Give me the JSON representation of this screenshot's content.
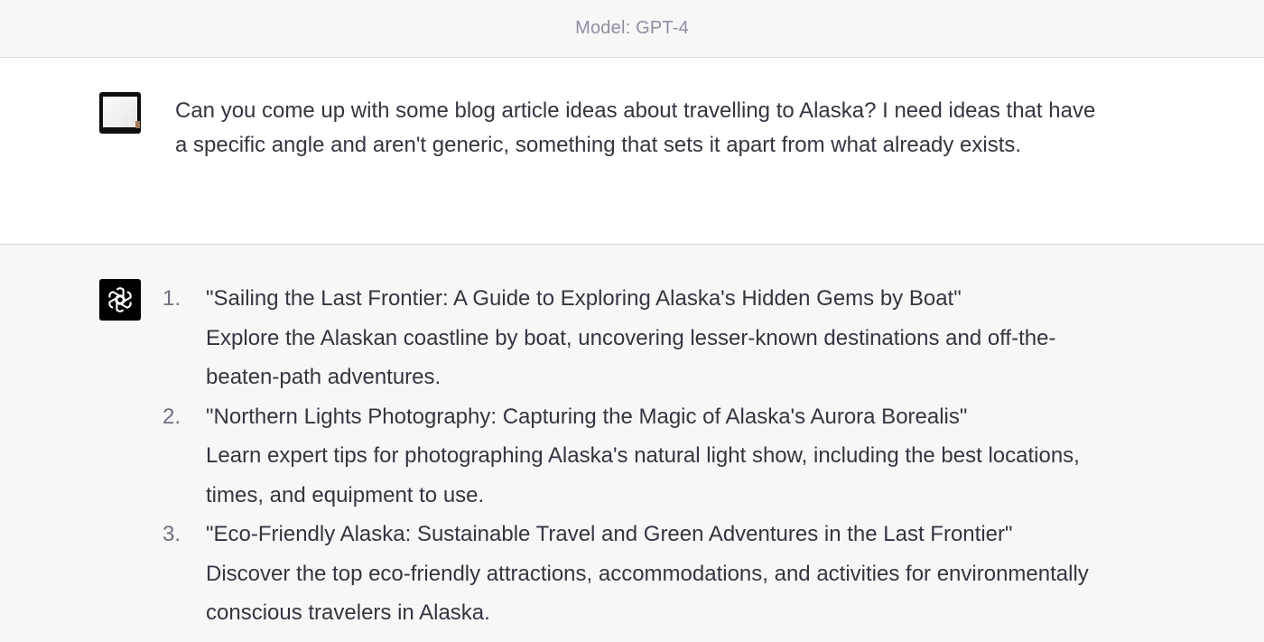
{
  "header": {
    "model_label": "Model: GPT-4"
  },
  "user_message": {
    "text": "Can you come up with some blog article ideas about travelling to Alaska? I need ideas that have a specific angle and aren't generic, something that sets it apart from what already exists."
  },
  "assistant_message": {
    "items": [
      {
        "number": "1.",
        "title": "\"Sailing the Last Frontier: A Guide to Exploring Alaska's Hidden Gems by Boat\"",
        "description": "Explore the Alaskan coastline by boat, uncovering lesser-known destinations and off-the-beaten-path adventures."
      },
      {
        "number": "2.",
        "title": "\"Northern Lights Photography: Capturing the Magic of Alaska's Aurora Borealis\"",
        "description": "Learn expert tips for photographing Alaska's natural light show, including the best locations, times, and equipment to use."
      },
      {
        "number": "3.",
        "title": "\"Eco-Friendly Alaska: Sustainable Travel and Green Adventures in the Last Frontier\"",
        "description": "Discover the top eco-friendly attractions, accommodations, and activities for environmentally conscious travelers in Alaska."
      }
    ]
  },
  "icons": {
    "user_avatar": "user-avatar-icon",
    "assistant_avatar": "openai-logo-icon"
  },
  "colors": {
    "text": "#343541",
    "muted": "#8e8ea0",
    "assistant_bg": "#f7f7f8",
    "user_bg": "#ffffff"
  }
}
